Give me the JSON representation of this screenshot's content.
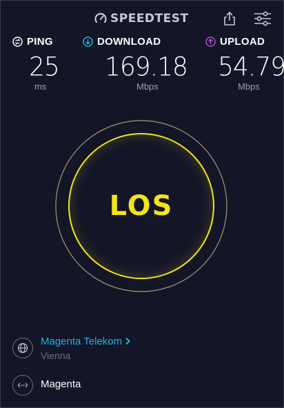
{
  "header": {
    "logo_text": "SPEEDTEST"
  },
  "metrics": {
    "ping": {
      "label": "PING",
      "value": "25",
      "unit": "ms",
      "icon": "ping-icon",
      "color": "#ffffff"
    },
    "download": {
      "label": "DOWNLOAD",
      "value": "169.18",
      "unit": "Mbps",
      "icon": "download-arrow-icon",
      "color": "#14b9e3"
    },
    "upload": {
      "label": "UPLOAD",
      "value": "54.79",
      "unit": "Mbps",
      "icon": "upload-arrow-icon",
      "color": "#b54ee3"
    }
  },
  "gauge": {
    "button_label": "LOS",
    "color": "#f2e41c"
  },
  "provider": {
    "isp_name": "Magenta Telekom",
    "isp_location": "Vienna",
    "server_name": "Magenta"
  }
}
